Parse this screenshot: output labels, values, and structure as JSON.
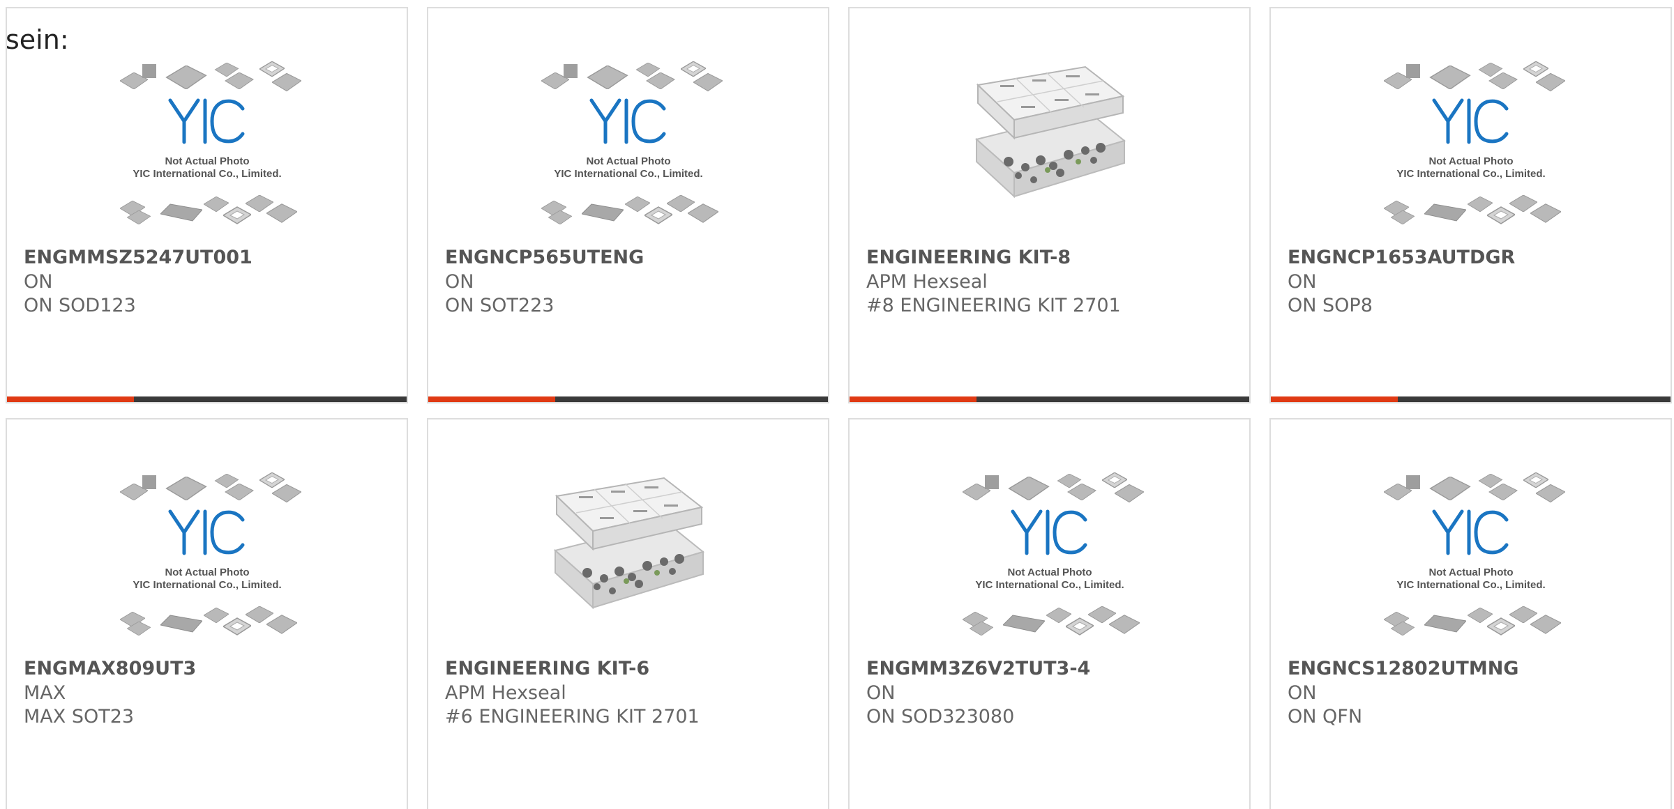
{
  "intro_text": "sein:",
  "placeholder": {
    "logo_text": "YIC",
    "caption_line1": "Not Actual Photo",
    "caption_line2": "YIC International Co., Limited."
  },
  "colors": {
    "accent_bar": "#e03a14",
    "dark_bar": "#3a3a3a",
    "logo_blue": "#1a75c2"
  },
  "products": [
    {
      "part_number": "ENGMMSZ5247UT001",
      "manufacturer": "ON",
      "description": "ON SOD123",
      "image": "placeholder"
    },
    {
      "part_number": "ENGNCP565UTENG",
      "manufacturer": "ON",
      "description": "ON SOT223",
      "image": "placeholder"
    },
    {
      "part_number": "ENGINEERING KIT-8",
      "manufacturer": "APM Hexseal",
      "description": "#8 ENGINEERING KIT 2701",
      "image": "kit-box"
    },
    {
      "part_number": "ENGNCP1653AUTDGR",
      "manufacturer": "ON",
      "description": "ON SOP8",
      "image": "placeholder"
    },
    {
      "part_number": "ENGMAX809UT3",
      "manufacturer": "MAX",
      "description": "MAX SOT23",
      "image": "placeholder"
    },
    {
      "part_number": "ENGINEERING KIT-6",
      "manufacturer": "APM Hexseal",
      "description": "#6 ENGINEERING KIT 2701",
      "image": "kit-box"
    },
    {
      "part_number": "ENGMM3Z6V2TUT3-4",
      "manufacturer": "ON",
      "description": "ON SOD323080",
      "image": "placeholder"
    },
    {
      "part_number": "ENGNCS12802UTMNG",
      "manufacturer": "ON",
      "description": "ON QFN",
      "image": "placeholder"
    }
  ]
}
